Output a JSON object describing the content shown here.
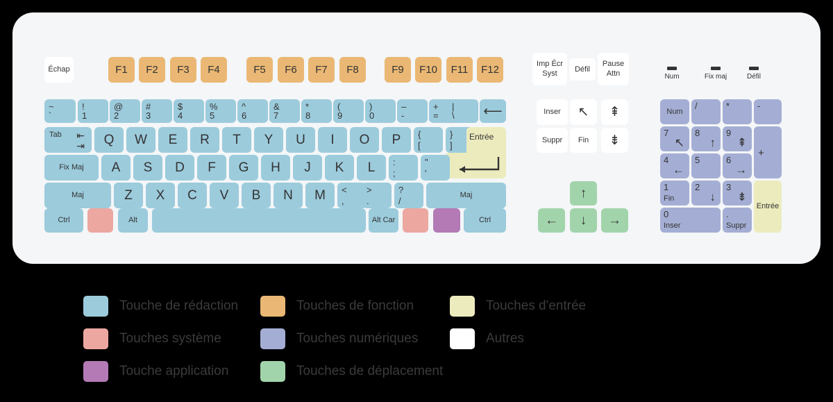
{
  "meta": {
    "title": "Disposition du clavier français (AZERTY/QWERTY) avec légende",
    "background_color": "#000000",
    "board_color": "#f4f6f8"
  },
  "colors": {
    "typing": "#9ccbdc",
    "function": "#eab874",
    "system": "#eda7a1",
    "application": "#b37ab5",
    "navigation": "#a2d4ab",
    "numeric": "#a4aed4",
    "enter": "#ecebbd",
    "other": "#ffffff"
  },
  "function_row": {
    "escape": "Échap",
    "groups": [
      [
        "F1",
        "F2",
        "F3",
        "F4"
      ],
      [
        "F5",
        "F6",
        "F7",
        "F8"
      ],
      [
        "F9",
        "F10",
        "F11",
        "F12"
      ]
    ]
  },
  "number_row": [
    {
      "top": "~",
      "bottom": "`"
    },
    {
      "top": "!",
      "bottom": "1"
    },
    {
      "top": "@",
      "bottom": "2"
    },
    {
      "top": "#",
      "bottom": "3"
    },
    {
      "top": "$",
      "bottom": "4"
    },
    {
      "top": "%",
      "bottom": "5"
    },
    {
      "top": "^",
      "bottom": "6"
    },
    {
      "top": "&",
      "bottom": "7"
    },
    {
      "top": "*",
      "bottom": "8"
    },
    {
      "top": "(",
      "bottom": "9"
    },
    {
      "top": ")",
      "bottom": "0"
    },
    {
      "top": "–",
      "bottom": "-"
    },
    {
      "top": "+",
      "bottom": "="
    },
    {
      "top": "|",
      "bottom": "\\"
    }
  ],
  "backspace": {
    "label": "⟵"
  },
  "tab_row": {
    "tab": {
      "label": "Tab",
      "arrow_left": "⇤",
      "arrow_right": "⇥"
    },
    "letters": [
      "Q",
      "W",
      "E",
      "R",
      "T",
      "Y",
      "U",
      "I",
      "O",
      "P"
    ],
    "brackets": [
      {
        "top": "{",
        "bottom": "["
      },
      {
        "top": "}",
        "bottom": "]"
      }
    ]
  },
  "home_row": {
    "caps": "Fix Maj",
    "letters": [
      "A",
      "S",
      "D",
      "F",
      "G",
      "H",
      "J",
      "K",
      "L"
    ],
    "punct": [
      {
        "top": ":",
        "bottom": ";"
      },
      {
        "top": "\"",
        "bottom": "'"
      }
    ],
    "enter": "Entrée"
  },
  "shift_row": {
    "shift_left": "Maj",
    "letters": [
      "Z",
      "X",
      "C",
      "V",
      "B",
      "N",
      "M"
    ],
    "punct": [
      {
        "top": "<",
        "bottom": ","
      },
      {
        "top": ">",
        "bottom": "."
      },
      {
        "top": "?",
        "bottom": "/"
      }
    ],
    "shift_right": "Maj"
  },
  "bottom_row": {
    "ctrl_left": "Ctrl",
    "win_left": "",
    "alt_left": "Alt",
    "space": "",
    "alt_right": "Alt Car",
    "win_right": "",
    "menu": "",
    "ctrl_right": "Ctrl"
  },
  "nav_cluster": {
    "top": [
      {
        "line1": "Imp Écr",
        "line2": "Syst"
      },
      {
        "line1": "Défil",
        "line2": ""
      },
      {
        "line1": "Pause",
        "line2": "Attn"
      }
    ],
    "middle": [
      {
        "label": "Inser",
        "glyph": ""
      },
      {
        "label": "",
        "glyph": "↖"
      },
      {
        "label": "",
        "glyph": "⇞"
      },
      {
        "label": "Suppr",
        "glyph": ""
      },
      {
        "label": "Fin",
        "glyph": ""
      },
      {
        "label": "",
        "glyph": "⇟"
      }
    ],
    "arrows": {
      "up": "↑",
      "left": "←",
      "down": "↓",
      "right": "→"
    }
  },
  "numpad": {
    "leds": [
      {
        "label": "Num"
      },
      {
        "label": "Fix maj"
      },
      {
        "label": "Défil"
      }
    ],
    "row1": [
      {
        "num": "Num",
        "glyph": "",
        "sub": ""
      },
      {
        "num": "/",
        "glyph": "",
        "sub": ""
      },
      {
        "num": "*",
        "glyph": "",
        "sub": ""
      },
      {
        "num": "-",
        "glyph": "",
        "sub": ""
      }
    ],
    "row2": [
      {
        "num": "7",
        "glyph": "↖",
        "sub": ""
      },
      {
        "num": "8",
        "glyph": "↑",
        "sub": ""
      },
      {
        "num": "9",
        "glyph": "⇞",
        "sub": ""
      }
    ],
    "row3": [
      {
        "num": "4",
        "glyph": "←",
        "sub": ""
      },
      {
        "num": "5",
        "glyph": "",
        "sub": ""
      },
      {
        "num": "6",
        "glyph": "→",
        "sub": ""
      }
    ],
    "row4": [
      {
        "num": "1",
        "glyph": "",
        "sub": "Fin"
      },
      {
        "num": "2",
        "glyph": "↓",
        "sub": ""
      },
      {
        "num": "3",
        "glyph": "⇟",
        "sub": ""
      }
    ],
    "row5": [
      {
        "num": "0",
        "glyph": "",
        "sub": "Inser"
      },
      {
        "num": ".",
        "glyph": "",
        "sub": "Suppr"
      }
    ],
    "plus": "+",
    "enter": "Entrée"
  },
  "legend": {
    "items": [
      {
        "label": "Touche de rédaction",
        "color": "#9ccbdc"
      },
      {
        "label": "Touches de fonction",
        "color": "#eab874"
      },
      {
        "label": "Touches d'entrée",
        "color": "#ecebbd"
      },
      {
        "label": "Touches système",
        "color": "#eda7a1"
      },
      {
        "label": "Touches numériques",
        "color": "#a4aed4"
      },
      {
        "label": "Autres",
        "color": "#ffffff"
      },
      {
        "label": "Touche application",
        "color": "#b37ab5"
      },
      {
        "label": "Touches de déplacement",
        "color": "#a2d4ab"
      }
    ]
  }
}
